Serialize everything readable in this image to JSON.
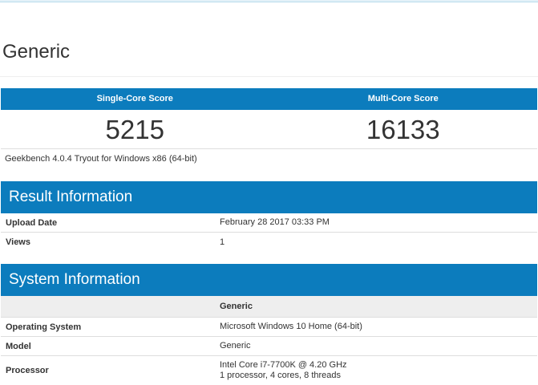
{
  "device": {
    "title": "Generic"
  },
  "scores": {
    "single_core_label": "Single-Core Score",
    "multi_core_label": "Multi-Core Score",
    "single_core_value": "5215",
    "multi_core_value": "16133",
    "version": "Geekbench 4.0.4 Tryout for Windows x86 (64-bit)"
  },
  "result_information": {
    "title": "Result Information",
    "upload_date_label": "Upload Date",
    "upload_date_value": "February 28 2017 03:33 PM",
    "views_label": "Views",
    "views_value": "1"
  },
  "system_information": {
    "title": "System Information",
    "sub_header": "Generic",
    "os_label": "Operating System",
    "os_value": "Microsoft Windows 10 Home (64-bit)",
    "model_label": "Model",
    "model_value": "Generic",
    "processor_label": "Processor",
    "processor_line1": "Intel Core i7-7700K @ 4.20 GHz",
    "processor_line2": "1 processor, 4 cores, 8 threads"
  },
  "colors": {
    "header_blue": "#0c7cbd",
    "subheader_grey": "#eeeeee",
    "divider": "#dddddd"
  }
}
